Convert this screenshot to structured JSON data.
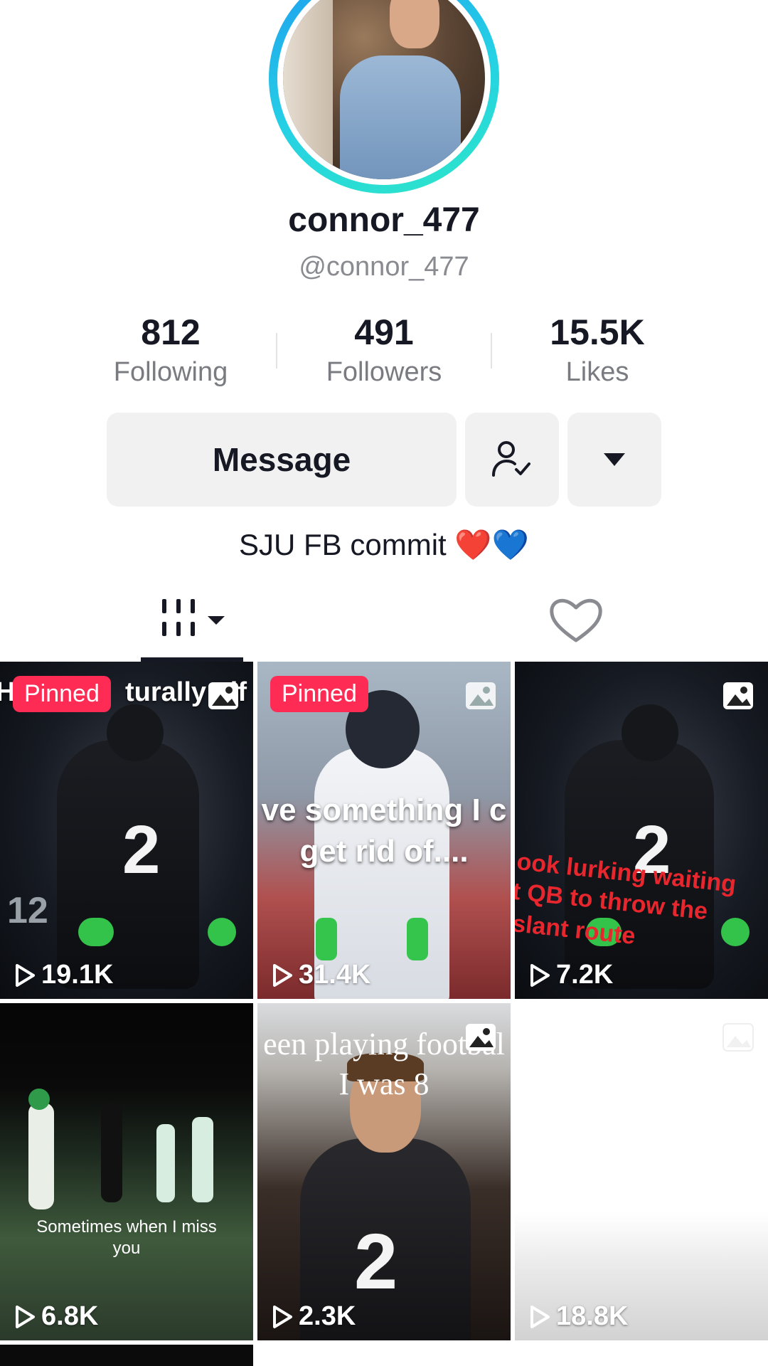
{
  "profile": {
    "display_name": "connor_477",
    "handle": "@connor_477",
    "bio_text": "SJU FB commit ",
    "bio_emoji_1": "❤️",
    "bio_emoji_2": "💙"
  },
  "stats": [
    {
      "value": "812",
      "label": "Following"
    },
    {
      "value": "491",
      "label": "Followers"
    },
    {
      "value": "15.5K",
      "label": "Likes"
    }
  ],
  "actions": {
    "message_label": "Message",
    "follow_icon": "person-check-icon",
    "more_icon": "caret-down-icon"
  },
  "tabs": [
    {
      "name": "videos",
      "icon": "grid-icon",
      "selected": true
    },
    {
      "name": "liked",
      "icon": "heart-outline-icon",
      "selected": false
    }
  ],
  "videos": [
    {
      "views": "19.1K",
      "pinned": "Pinned",
      "caption": "H",
      "caption_right": "turally gif",
      "photo_icon": true
    },
    {
      "views": "31.4K",
      "pinned": "Pinned",
      "caption_line1": "ve something I c",
      "caption_line2": "get rid of....",
      "photo_icon": true
    },
    {
      "views": "7.2K",
      "caption_line1": "ook lurking waiting",
      "caption_line2": "t QB to throw the",
      "caption_line3": "slant route",
      "photo_icon": true
    },
    {
      "views": "6.8K",
      "caption_line1": "Sometimes when I miss",
      "caption_line2": "you"
    },
    {
      "views": "2.3K",
      "caption_line1": "een playing footbal",
      "caption_line2": "I was 8",
      "photo_icon": true
    },
    {
      "views": "18.8K",
      "photo_icon": true
    }
  ],
  "colors": {
    "pinned_bg": "#fe2c55",
    "button_bg": "#f1f1f2",
    "ring_start": "#1e9bf0",
    "ring_end": "#2ee6c8"
  }
}
